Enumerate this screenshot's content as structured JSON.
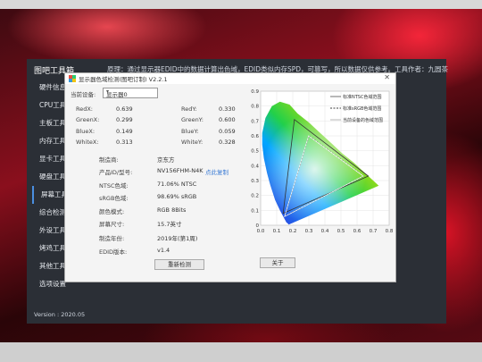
{
  "app": {
    "title": "图吧工具箱",
    "notice": "原理：通过显示器EDID中的数据计算出色域，EDID类似内存SPD，可篡写，所以数据仅供参考。工具作者：九圆茶",
    "sidebar": [
      "硬件信息",
      "CPU工具",
      "主板工具",
      "内存工具",
      "显卡工具",
      "硬盘工具",
      "屏幕工具",
      "综合检测",
      "外设工具",
      "烤鸡工具",
      "其他工具",
      "选项设置"
    ],
    "version": "Version : 2020.05"
  },
  "dialog": {
    "title": "显示器色域检测(图吧订制) V2.2.1",
    "device_label": "当前设备:",
    "device_value": "显示器0",
    "coords": [
      {
        "l1": "RedX:",
        "v1": "0.639",
        "l2": "RedY:",
        "v2": "0.330"
      },
      {
        "l1": "GreenX:",
        "v1": "0.299",
        "l2": "GreenY:",
        "v2": "0.600"
      },
      {
        "l1": "BlueX:",
        "v1": "0.149",
        "l2": "BlueY:",
        "v2": "0.059"
      },
      {
        "l1": "WhiteX:",
        "v1": "0.313",
        "l2": "WhiteY:",
        "v2": "0.328"
      }
    ],
    "info": [
      {
        "label": "制造商:",
        "value": "京东方"
      },
      {
        "label": "产品ID/型号:",
        "value": "NV156FHM-N4K"
      },
      {
        "label": "NTSC色域:",
        "value": "71.06% NTSC"
      },
      {
        "label": "sRGB色域:",
        "value": "98.69% sRGB"
      },
      {
        "label": "颜色模式:",
        "value": "RGB 8Bits"
      },
      {
        "label": "屏幕尺寸:",
        "value": "15.7英寸"
      },
      {
        "label": "制造年份:",
        "value": "2019年(第1周)"
      },
      {
        "label": "EDID版本:",
        "value": "v1.4"
      }
    ],
    "copy_link": "点此复制",
    "redetect_button": "重新检测",
    "about_button": "关于",
    "legend": [
      "标准NTSC色域范围",
      "标准sRGB色域范围",
      "当前设备的色域范围"
    ]
  },
  "chart_data": {
    "type": "scatter",
    "title": "",
    "xlabel": "",
    "ylabel": "",
    "xlim": [
      0.0,
      0.8
    ],
    "ylim": [
      0.0,
      0.9
    ],
    "x_ticks": [
      "0.0",
      "0.1",
      "0.2",
      "0.3",
      "0.4",
      "0.5",
      "0.6",
      "0.7",
      "0.8"
    ],
    "y_ticks": [
      "0",
      "0.1",
      "0.2",
      "0.3",
      "0.4",
      "0.5",
      "0.6",
      "0.7",
      "0.8",
      "0.9"
    ],
    "series": [
      {
        "name": "标准NTSC色域范围",
        "points": [
          [
            0.67,
            0.33
          ],
          [
            0.21,
            0.71
          ],
          [
            0.14,
            0.08
          ]
        ]
      },
      {
        "name": "标准sRGB色域范围",
        "points": [
          [
            0.64,
            0.33
          ],
          [
            0.3,
            0.6
          ],
          [
            0.15,
            0.06
          ]
        ]
      },
      {
        "name": "当前设备的色域范围",
        "points": [
          [
            0.639,
            0.33
          ],
          [
            0.299,
            0.6
          ],
          [
            0.149,
            0.059
          ]
        ]
      }
    ],
    "colors": {
      "ntsc": "#333333",
      "srgb": "#000000",
      "device": "#ffffff"
    }
  }
}
